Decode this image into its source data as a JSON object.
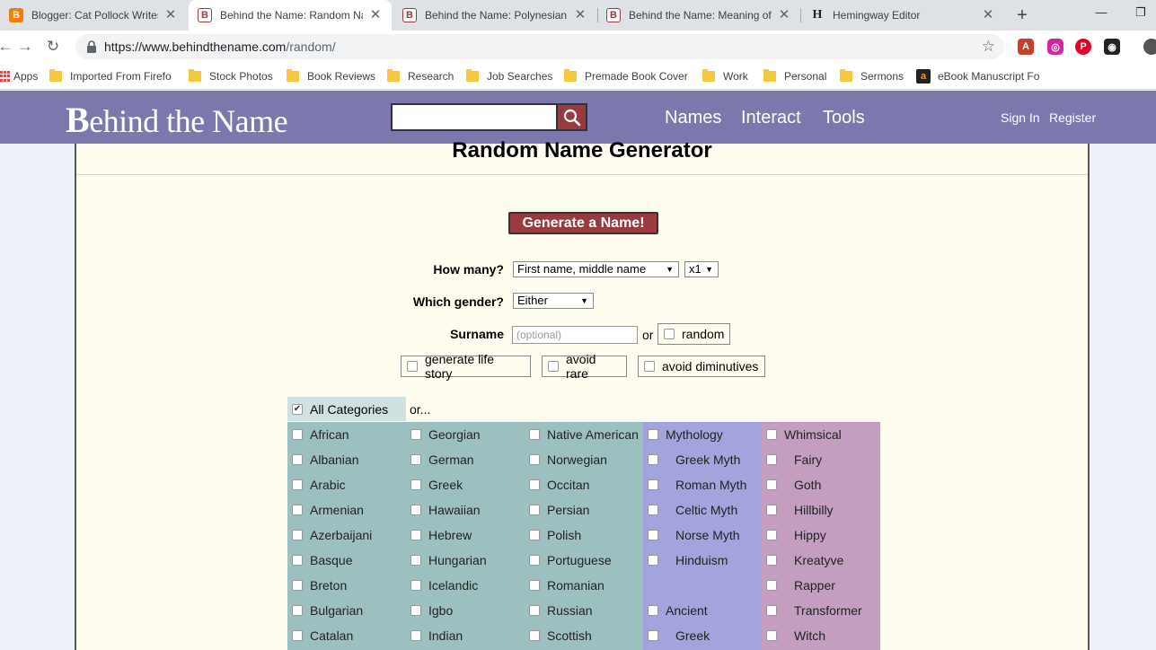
{
  "browser": {
    "tabs": [
      {
        "title": "Blogger: Cat Pollock Writes - E",
        "favicon": "blogger-icon"
      },
      {
        "title": "Behind the Name: Random Na",
        "favicon": "btn-icon"
      },
      {
        "title": "Behind the Name: Polynesian S",
        "favicon": "btn-icon"
      },
      {
        "title": "Behind the Name: Meaning of",
        "favicon": "btn-icon"
      },
      {
        "title": "Hemingway Editor",
        "favicon": "hemingway-icon"
      }
    ],
    "favicon_letters": {
      "blogger": "B",
      "btn": "B",
      "hemingway": "H"
    },
    "url_host": "https://www.behindthename.com",
    "url_path": "/random/",
    "bookmarks": [
      "Apps",
      "Imported From Firefo",
      "Stock Photos",
      "Book Reviews",
      "Research",
      "Job Searches",
      "Premade Book Cover",
      "Work",
      "Personal",
      "Sermons",
      "eBook Manuscript Fo"
    ]
  },
  "site": {
    "logo_b": "B",
    "logo_rest": "ehind the Name",
    "nav": [
      "Names",
      "Interact",
      "Tools"
    ],
    "user_nav": [
      "Sign In",
      "Register"
    ]
  },
  "generator": {
    "title": "Random Name Generator",
    "generate_label": "Generate a Name!",
    "how_many_label": "How many?",
    "how_many_value": "First name, middle name",
    "count_value": "x1",
    "gender_label": "Which gender?",
    "gender_value": "Either",
    "surname_label": "Surname",
    "surname_placeholder": "(optional)",
    "or_text": "or",
    "random_label": "random",
    "life_story_label": "generate life story",
    "avoid_rare_label": "avoid rare",
    "avoid_diminutives_label": "avoid diminutives",
    "all_categories_label": "All Categories",
    "categories_or": "or...",
    "columns": [
      {
        "color": "#9cc0bf",
        "items": [
          "African",
          "Albanian",
          "Arabic",
          "Armenian",
          "Azerbaijani",
          "Basque",
          "Breton",
          "Bulgarian",
          "Catalan"
        ]
      },
      {
        "color": "#9cc0bf",
        "items": [
          "Georgian",
          "German",
          "Greek",
          "Hawaiian",
          "Hebrew",
          "Hungarian",
          "Icelandic",
          "Igbo",
          "Indian"
        ]
      },
      {
        "color": "#9cc0bf",
        "items": [
          "Native American",
          "Norwegian",
          "Occitan",
          "Persian",
          "Polish",
          "Portuguese",
          "Romanian",
          "Russian",
          "Scottish"
        ]
      },
      {
        "color": "#a3a3dd",
        "items": [
          "Mythology",
          "Greek Myth",
          "Roman Myth",
          "Celtic Myth",
          "Norse Myth",
          "Hinduism",
          "",
          "Ancient",
          "Greek"
        ]
      },
      {
        "color": "#c39ec0",
        "items": [
          "Whimsical",
          "Fairy",
          "Goth",
          "Hillbilly",
          "Hippy",
          "Kreatyve",
          "Rapper",
          "Transformer",
          "Witch"
        ]
      }
    ]
  },
  "colors": {
    "header_bg": "#7b78ad",
    "button_bg": "#9a3a3f",
    "content_bg": "#fffdef",
    "teal": "#9cc0bf",
    "blue": "#a3a3dd",
    "mauve": "#c39ec0"
  }
}
